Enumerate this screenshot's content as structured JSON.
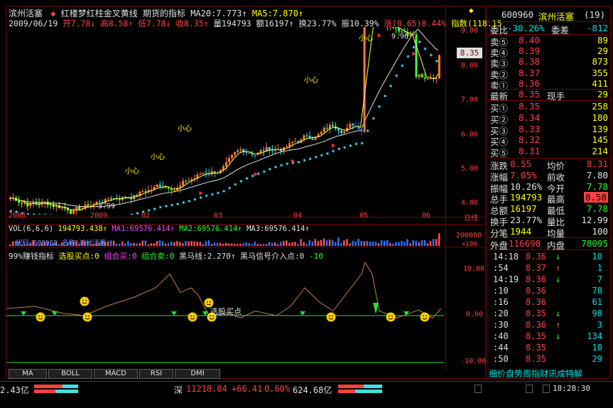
{
  "price_header": {
    "stock_name": "滨州活塞",
    "indicator_title": "红楼梦红柱金叉黄线 期货的指标",
    "ma20_label": "MA20:7.773",
    "ma20_arrow": "↑",
    "ma5_label": "MA5:7.870",
    "ma5_arrow": "↑"
  },
  "price_info": {
    "date": "2009/06/19",
    "open": "开7.78",
    "open_arrow": "↓",
    "high": "高8.58",
    "high_arrow": "↑",
    "low": "低7.78",
    "low_arrow": "↓",
    "close": "收8.35",
    "close_arrow": "↑",
    "volume": "量194793",
    "amount": "额16197",
    "amount_arrow": "↑",
    "turnover": "换23.77%",
    "amplitude": "振10.39%",
    "change": "涨(0.65)8.44%",
    "index": "指数(118.15"
  },
  "price_axis": [
    "9.00",
    "8.00",
    "7.00",
    "6.00",
    "5.00",
    "4.00"
  ],
  "current_price_tag": "8.35",
  "annotations": {
    "peak_price": "9.96",
    "low_price": "3.99",
    "small_heart_1": "小心",
    "small_heart_2": "小心",
    "small_heart_3": "小心",
    "small_heart_4": "小心",
    "small_heart_5": "小心"
  },
  "time_axis": [
    "2008",
    "2009",
    "02",
    "03",
    "04",
    "05",
    "06",
    "日线"
  ],
  "volume_panel": {
    "vol_label": "VOL(6,6,6)",
    "vol_value": "194793.438",
    "vol_arrow": "↑",
    "ma1": "MA1:69576.414",
    "ma1_arrow": "↑",
    "ma2": "MA2:69576.414",
    "ma2_arrow": "↑",
    "ma3": "MA3:69576.414",
    "ma3_arrow": "↑",
    "axis_top": "200000",
    "axis_unit": "×100",
    "overlay_text": "代码:600960 名称:滨州活塞"
  },
  "indicator_panel": {
    "name": "99%赚钱指标",
    "buy_point": "选股买点:0",
    "combo_buy": "组合买:0",
    "combo_sell": "组合卖:0",
    "black_horse": "黑马线:2.270",
    "black_horse_arrow": "↑",
    "signal": "黑马信号介入点:0",
    "signal_value": "-10",
    "axis": [
      "10.00",
      "0.00",
      "-10.00"
    ],
    "buy_label": "选股买点"
  },
  "tabs": [
    "MA",
    "BOLL",
    "MACD",
    "RSI",
    "DMI"
  ],
  "quote": {
    "code": "600960",
    "name": "滨州活塞",
    "num": "(19)",
    "webi_label": "委比",
    "webi_value": "-30.26%",
    "weicha_label": "委差",
    "weicha_value": "-812",
    "sells": [
      {
        "label": "卖⑤",
        "price": "8.40",
        "vol": "89"
      },
      {
        "label": "卖④",
        "price": "8.39",
        "vol": "29"
      },
      {
        "label": "卖③",
        "price": "8.38",
        "vol": "873"
      },
      {
        "label": "卖②",
        "price": "8.37",
        "vol": "355"
      },
      {
        "label": "卖①",
        "price": "8.36",
        "vol": "411"
      }
    ],
    "latest_label": "最新",
    "latest_value": "8.35",
    "xianshou_label": "现手",
    "xianshou_value": "29",
    "buys": [
      {
        "label": "买①",
        "price": "8.35",
        "vol": "258"
      },
      {
        "label": "买②",
        "price": "8.34",
        "vol": "180"
      },
      {
        "label": "买③",
        "price": "8.33",
        "vol": "139"
      },
      {
        "label": "买④",
        "price": "8.32",
        "vol": "145"
      },
      {
        "label": "买⑤",
        "price": "8.31",
        "vol": "214"
      }
    ],
    "stats": [
      {
        "l1": "涨跌",
        "v1": "0.55",
        "l2": "均价",
        "v2": "8.31"
      },
      {
        "l1": "涨幅",
        "v1": "7.05%",
        "l2": "前收",
        "v2": "7.80"
      },
      {
        "l1": "振幅",
        "v1": "10.26%",
        "l2": "今开",
        "v2": "7.78"
      },
      {
        "l1": "总手",
        "v1": "194793",
        "l2": "最高",
        "v2": "8.58"
      },
      {
        "l1": "总额",
        "v1": "16197",
        "l2": "最低",
        "v2": "7.78"
      },
      {
        "l1": "换手",
        "v1": "23.77%",
        "l2": "量比",
        "v2": "12.99"
      },
      {
        "l1": "分笔",
        "v1": "1944",
        "l2": "均量",
        "v2": "100"
      }
    ],
    "waipan_label": "外盘",
    "waipan_value": "116698",
    "neipan_label": "内盘",
    "neipan_value": "78095"
  },
  "ticks": [
    {
      "time": "14:18",
      "price": "8.36",
      "vol": "10",
      "dir": "↓"
    },
    {
      "time": ":54",
      "price": "8.37",
      "vol": "1",
      "dir": "↑"
    },
    {
      "time": "14:19",
      "price": "8.36",
      "vol": "7",
      "dir": "↓"
    },
    {
      "time": ":10",
      "price": "8.36",
      "vol": "78",
      "dir": ""
    },
    {
      "time": ":16",
      "price": "8.36",
      "vol": "61",
      "dir": ""
    },
    {
      "time": ":20",
      "price": "8.35",
      "vol": "98",
      "dir": "↓"
    },
    {
      "time": ":30",
      "price": "8.36",
      "vol": "3",
      "dir": "↑"
    },
    {
      "time": ":40",
      "price": "8.35",
      "vol": "134",
      "dir": "↓"
    },
    {
      "time": ":44",
      "price": "8.35",
      "vol": "10",
      "dir": ""
    },
    {
      "time": ":50",
      "price": "8.35",
      "vol": "29",
      "dir": ""
    }
  ],
  "bottom_tabs_text": "细价盘势周指财讯成特解",
  "status": {
    "left_value": "2.43亿",
    "shen_label": "深",
    "shen_index": "11218.04",
    "shen_change": "+66.41",
    "shen_pct": "0.60%",
    "shen_amount": "624.68亿",
    "time": "18:28:30"
  }
}
